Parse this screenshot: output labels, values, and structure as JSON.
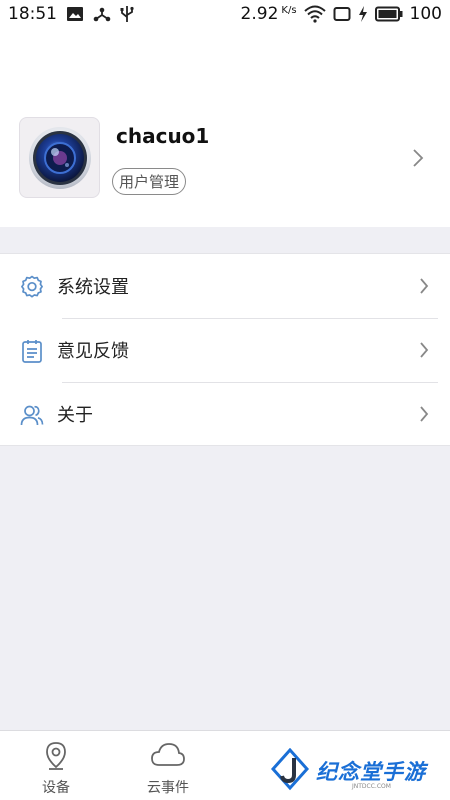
{
  "status_bar": {
    "time": "18:51",
    "speed": "2.92",
    "speed_unit": "K/s",
    "battery": "100"
  },
  "profile": {
    "username": "chacuo1",
    "user_manage_label": "用户管理"
  },
  "menu": {
    "items": [
      {
        "label": "系统设置",
        "icon": "gear-icon"
      },
      {
        "label": "意见反馈",
        "icon": "feedback-icon"
      },
      {
        "label": "关于",
        "icon": "people-icon"
      }
    ]
  },
  "bottom_nav": {
    "tabs": [
      {
        "label": "设备",
        "icon": "location-pin-icon"
      },
      {
        "label": "云事件",
        "icon": "cloud-icon"
      },
      {
        "label": "",
        "icon": "tab-icon"
      },
      {
        "label": "",
        "icon": "profile-icon"
      }
    ]
  },
  "watermark": {
    "text": "纪念堂手游",
    "sub": "JNTDCC.COM"
  },
  "colors": {
    "background": "#efeff4",
    "accent": "#4a90e2",
    "icon_blue": "#5b8fc9",
    "watermark_blue": "#1a6fd6"
  }
}
